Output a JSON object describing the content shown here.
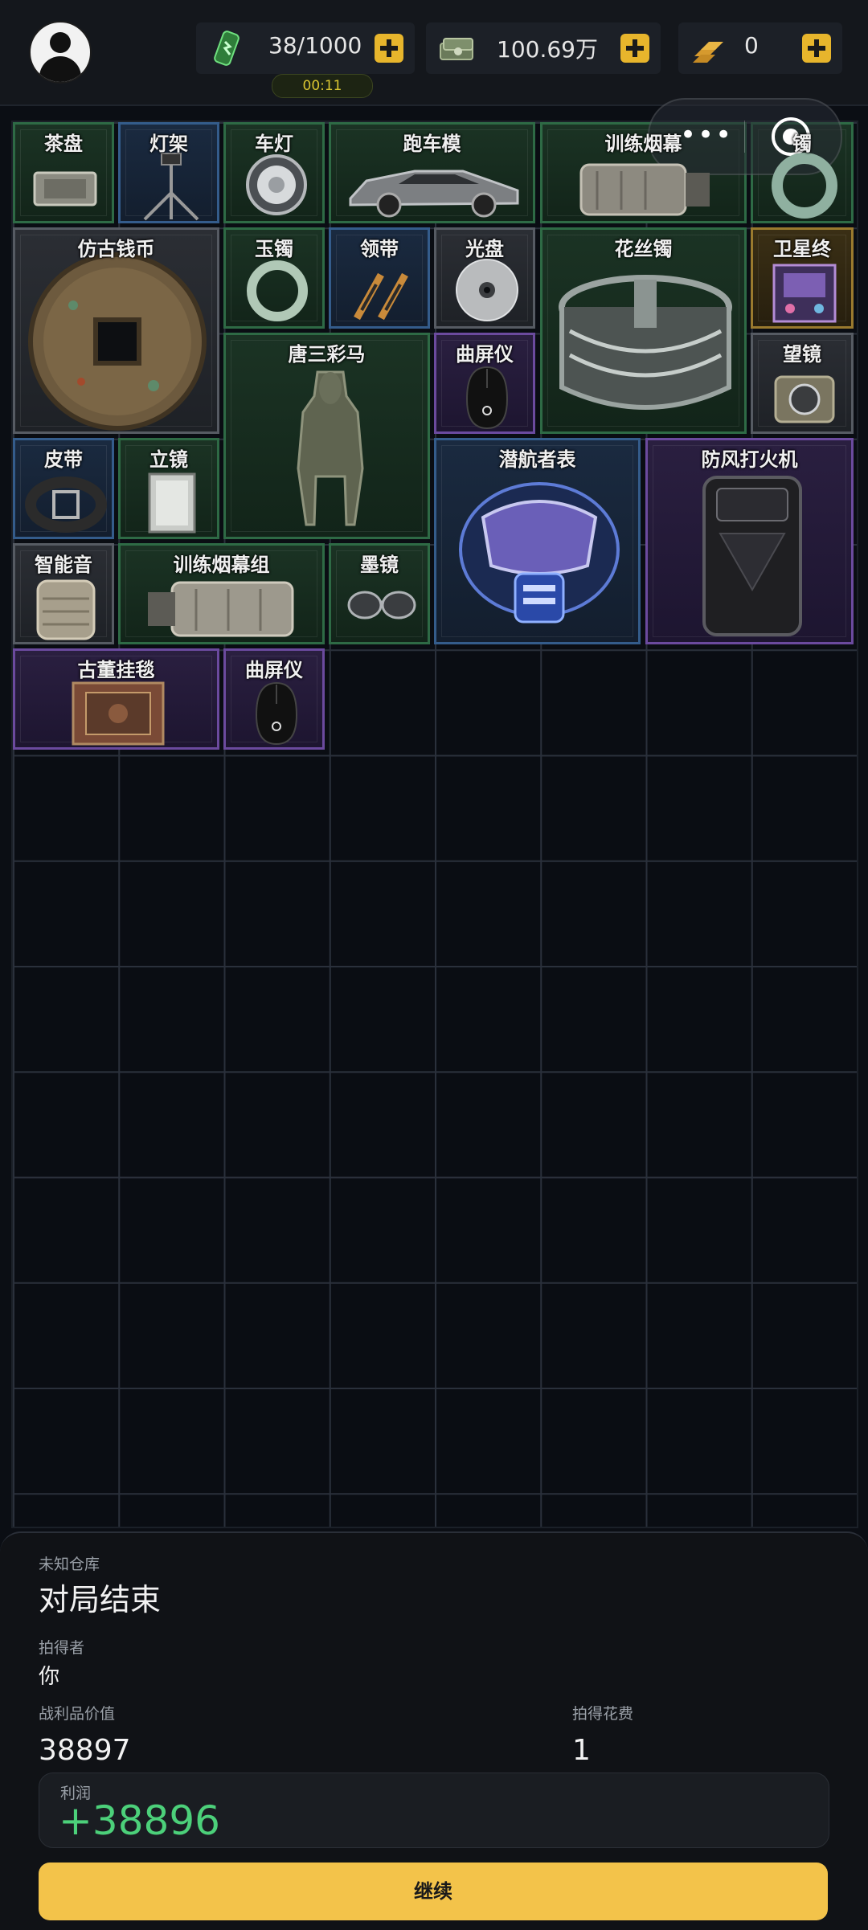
{
  "topbar": {
    "energy_value": "38/1000",
    "money_value": "100.69万",
    "gold_value": "0",
    "timer": "00:11"
  },
  "items": [
    {
      "name": "茶盘",
      "rarity": "green",
      "icon": "tea-tray-icon"
    },
    {
      "name": "灯架",
      "rarity": "blue",
      "icon": "tripod-icon"
    },
    {
      "name": "车灯",
      "rarity": "green",
      "icon": "car-light-icon"
    },
    {
      "name": "跑车模",
      "rarity": "green",
      "icon": "car-model-icon"
    },
    {
      "name": "训练烟幕",
      "rarity": "green",
      "icon": "smoke-grenade-icon"
    },
    {
      "name": "镯",
      "rarity": "green",
      "icon": "jade-bracelet-icon"
    },
    {
      "name": "仿古钱币",
      "rarity": "gray",
      "icon": "ancient-coin-icon"
    },
    {
      "name": "玉镯",
      "rarity": "green",
      "icon": "jade-bracelet-icon"
    },
    {
      "name": "领带",
      "rarity": "blue",
      "icon": "tie-icon"
    },
    {
      "name": "光盘",
      "rarity": "gray",
      "icon": "disc-icon"
    },
    {
      "name": "花丝镯",
      "rarity": "green",
      "icon": "filigree-bracelet-icon"
    },
    {
      "name": "卫星终",
      "rarity": "gold",
      "icon": "satellite-terminal-icon"
    },
    {
      "name": "唐三彩马",
      "rarity": "green",
      "icon": "tang-horse-icon"
    },
    {
      "name": "曲屏仪",
      "rarity": "purple",
      "icon": "mouse-icon"
    },
    {
      "name": "望镜",
      "rarity": "gray",
      "icon": "scope-icon"
    },
    {
      "name": "皮带",
      "rarity": "blue",
      "icon": "belt-icon"
    },
    {
      "name": "立镜",
      "rarity": "green",
      "icon": "mirror-icon"
    },
    {
      "name": "潜航者表",
      "rarity": "blue",
      "icon": "diving-mask-icon"
    },
    {
      "name": "防风打火机",
      "rarity": "purple",
      "icon": "lighter-icon"
    },
    {
      "name": "智能音",
      "rarity": "gray",
      "icon": "speaker-icon"
    },
    {
      "name": "训练烟幕组",
      "rarity": "green",
      "icon": "smoke-grenade-icon"
    },
    {
      "name": "墨镜",
      "rarity": "green",
      "icon": "sunglasses-icon"
    },
    {
      "name": "古董挂毯",
      "rarity": "purple",
      "icon": "tapestry-icon"
    },
    {
      "name": "曲屏仪",
      "rarity": "purple",
      "icon": "mouse-icon"
    }
  ],
  "result": {
    "warehouse_label": "未知仓库",
    "title": "对局结束",
    "winner_label": "拍得者",
    "winner_value": "你",
    "loot_label": "战利品价值",
    "loot_value": "38897",
    "cost_label": "拍得花费",
    "cost_value": "1",
    "profit_label": "利润",
    "profit_value": "+38896",
    "continue_label": "继续"
  },
  "colors": {
    "accent": "#f3c34a",
    "profit": "#4cd07a",
    "green_rarity": "#2e6a45",
    "blue_rarity": "#345c8b",
    "purple_rarity": "#6b4a9e",
    "gold_rarity": "#9a7a2e"
  }
}
